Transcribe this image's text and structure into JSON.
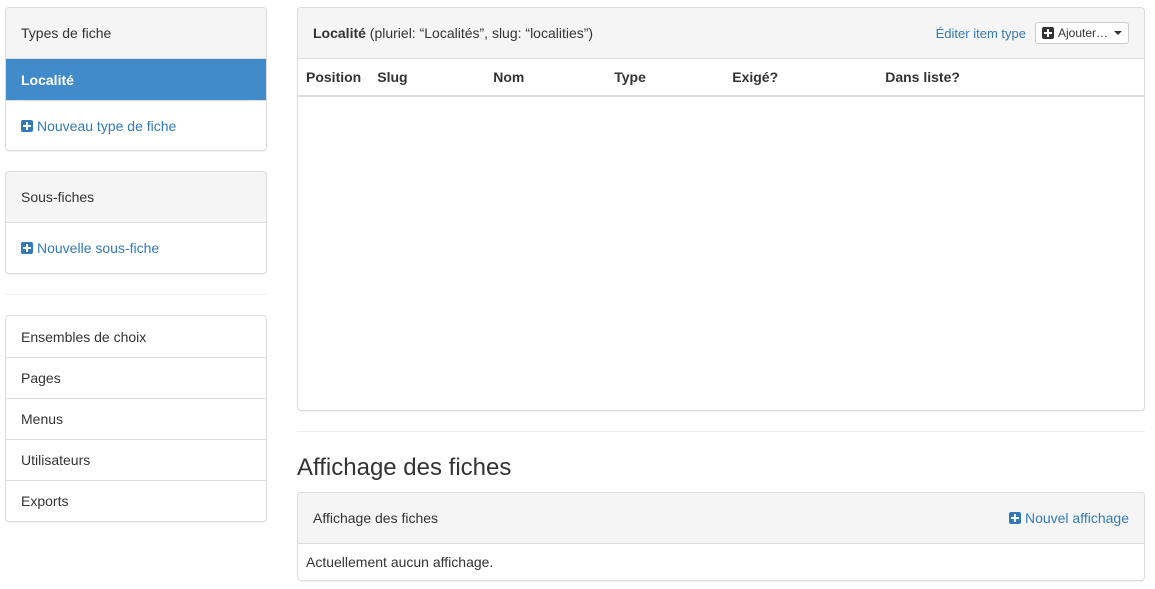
{
  "sidebar": {
    "card_types": {
      "title": "Types de fiche",
      "active_item": "Localité",
      "new_link": "Nouveau type de fiche"
    },
    "subcards": {
      "title": "Sous-fiches",
      "new_link": "Nouvelle sous-fiche"
    },
    "nav": [
      {
        "label": "Ensembles de choix"
      },
      {
        "label": "Pages"
      },
      {
        "label": "Menus"
      },
      {
        "label": "Utilisateurs"
      },
      {
        "label": "Exports"
      }
    ]
  },
  "main": {
    "card_panel": {
      "title": "Localité",
      "subtitle": " (pluriel: “Localités”, slug: “localities”)",
      "edit_link": "Éditer item type",
      "add_button": "Ajouter…",
      "columns": [
        "Position",
        "Slug",
        "Nom",
        "Type",
        "Exigé?",
        "Dans liste?"
      ]
    },
    "display_section": {
      "heading": "Affichage des fiches",
      "panel_title": "Affichage des fiches",
      "new_link": "Nouvel affichage",
      "empty_text": "Actuellement aucun affichage."
    }
  },
  "colors": {
    "primary": "#428bca",
    "link": "#337ab7"
  }
}
